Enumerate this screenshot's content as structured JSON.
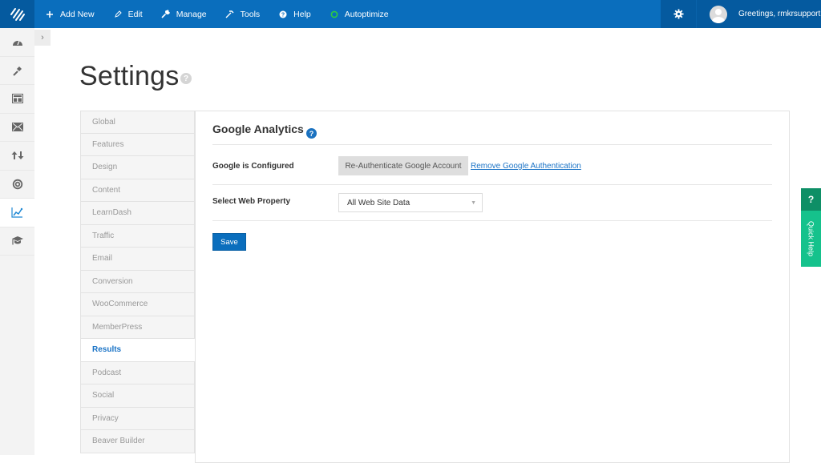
{
  "topbar": {
    "logo_icon": "brand-logo-icon",
    "nav": [
      {
        "label": "Add New",
        "icon": "plus-icon"
      },
      {
        "label": "Edit",
        "icon": "pencil-icon"
      },
      {
        "label": "Manage",
        "icon": "wrench-icon"
      },
      {
        "label": "Tools",
        "icon": "hammer-icon"
      },
      {
        "label": "Help",
        "icon": "help-circle-icon"
      },
      {
        "label": "Autoptimize",
        "icon": "status-circle-icon",
        "status_color": "#2ecc40"
      }
    ],
    "settings_icon": "gear-icon",
    "greeting": "Greetings, rmkrsupport"
  },
  "rail": {
    "items": [
      {
        "name": "dashboard",
        "icon": "dashboard-icon",
        "active": false
      },
      {
        "name": "design",
        "icon": "brush-icon",
        "active": false
      },
      {
        "name": "content",
        "icon": "layout-icon",
        "active": false
      },
      {
        "name": "email",
        "icon": "envelope-icon",
        "active": false
      },
      {
        "name": "traffic",
        "icon": "arrows-icon",
        "active": false
      },
      {
        "name": "conversion",
        "icon": "target-icon",
        "active": false
      },
      {
        "name": "results",
        "icon": "chart-line-icon",
        "active": true
      },
      {
        "name": "learning",
        "icon": "graduation-cap-icon",
        "active": false
      }
    ],
    "expander_label": "›"
  },
  "page": {
    "title": "Settings",
    "help_glyph": "?"
  },
  "tabs": [
    {
      "label": "Global",
      "active": false
    },
    {
      "label": "Features",
      "active": false
    },
    {
      "label": "Design",
      "active": false
    },
    {
      "label": "Content",
      "active": false
    },
    {
      "label": "LearnDash",
      "active": false
    },
    {
      "label": "Traffic",
      "active": false
    },
    {
      "label": "Email",
      "active": false
    },
    {
      "label": "Conversion",
      "active": false
    },
    {
      "label": "WooCommerce",
      "active": false
    },
    {
      "label": "MemberPress",
      "active": false
    },
    {
      "label": "Results",
      "active": true
    },
    {
      "label": "Podcast",
      "active": false
    },
    {
      "label": "Social",
      "active": false
    },
    {
      "label": "Privacy",
      "active": false
    },
    {
      "label": "Beaver Builder",
      "active": false
    }
  ],
  "panel": {
    "section_title": "Google Analytics",
    "help_glyph": "?",
    "row1_label": "Google is Configured",
    "reauth_button": "Re-Authenticate Google Account",
    "remove_link": "Remove Google Authentication",
    "row2_label": "Select Web Property",
    "web_property_value": "All Web Site Data",
    "caret": "▼",
    "save_button": "Save"
  },
  "quick_help": {
    "glyph": "?",
    "label": "Quick Help"
  },
  "colors": {
    "topbar": "#0a6ebd",
    "topbar_dark": "#055a9f",
    "accent_link": "#1a73c6",
    "quick_help_dark": "#0e8f66",
    "quick_help": "#15c28c"
  }
}
